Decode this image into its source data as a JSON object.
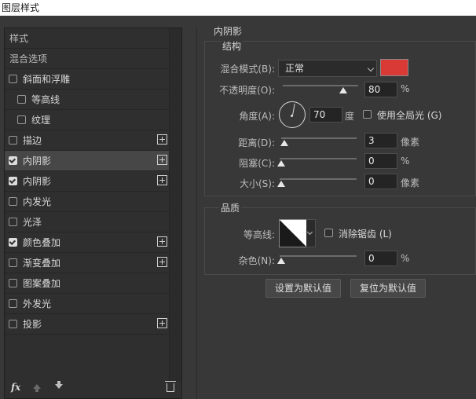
{
  "window": {
    "title": "图层样式"
  },
  "sidebar": {
    "items": [
      {
        "label": "样式",
        "type": "plain"
      },
      {
        "label": "混合选项",
        "type": "plain"
      },
      {
        "label": "斜面和浮雕",
        "checked": false
      },
      {
        "label": "等高线",
        "checked": false,
        "indent": true
      },
      {
        "label": "纹理",
        "checked": false,
        "indent": true
      },
      {
        "label": "描边",
        "checked": false,
        "plus": true
      },
      {
        "label": "内阴影",
        "checked": true,
        "plus": true,
        "selected": true
      },
      {
        "label": "内阴影",
        "checked": true,
        "plus": true
      },
      {
        "label": "内发光",
        "checked": false
      },
      {
        "label": "光泽",
        "checked": false
      },
      {
        "label": "颜色叠加",
        "checked": true,
        "plus": true
      },
      {
        "label": "渐变叠加",
        "checked": false,
        "plus": true
      },
      {
        "label": "图案叠加",
        "checked": false
      },
      {
        "label": "外发光",
        "checked": false
      },
      {
        "label": "投影",
        "checked": false,
        "plus": true
      }
    ],
    "fx_label": "fx"
  },
  "panel": {
    "title": "内阴影",
    "structure": {
      "title": "结构",
      "blend_mode_label": "混合模式(B):",
      "blend_mode_value": "正常",
      "color": "#d93a35",
      "opacity_label": "不透明度(O):",
      "opacity_value": "80",
      "opacity_unit": "%",
      "opacity_fraction": 0.8,
      "angle_label": "角度(A):",
      "angle_value": "70",
      "angle_unit": "度",
      "global_light_label": "使用全局光 (G)",
      "distance_label": "距离(D):",
      "distance_value": "3",
      "distance_unit": "像素",
      "choke_label": "阻塞(C):",
      "choke_value": "0",
      "choke_unit": "%",
      "size_label": "大小(S):",
      "size_value": "0",
      "size_unit": "像素"
    },
    "quality": {
      "title": "品质",
      "contour_label": "等高线:",
      "antialias_label": "消除锯齿 (L)",
      "noise_label": "杂色(N):",
      "noise_value": "0",
      "noise_unit": "%"
    },
    "buttons": {
      "set_default": "设置为默认值",
      "reset_default": "复位为默认值"
    }
  }
}
